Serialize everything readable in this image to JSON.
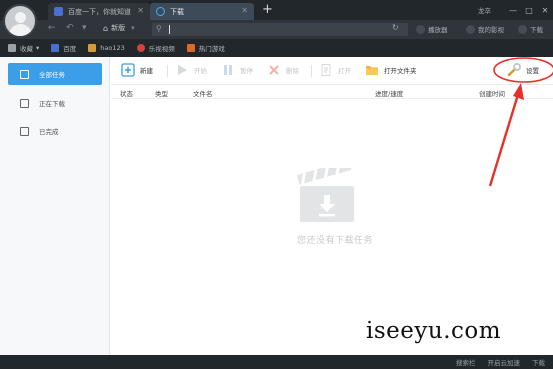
{
  "window": {
    "tabs": [
      {
        "label": "百度一下，你就知道",
        "active": false
      },
      {
        "label": "下载",
        "active": true
      }
    ],
    "new_tab_symbol": "+",
    "title_right_label": "龙卒",
    "window_buttons": [
      "—",
      "□",
      "✕"
    ]
  },
  "addressbar": {
    "home_label": "新版",
    "url_value": "",
    "quick_actions": [
      "播放器",
      "我的影视",
      "下载"
    ]
  },
  "bookmarks": [
    {
      "label": "收藏",
      "color": "#9aa0a6"
    },
    {
      "label": "百度",
      "color": "#4a6fd0"
    },
    {
      "label": "hao123",
      "color": "#d39b3a"
    },
    {
      "label": "乐视视频",
      "color": "#d0453a"
    },
    {
      "label": "热门游戏",
      "color": "#e0672a"
    }
  ],
  "sidebar": {
    "items": [
      {
        "label": "全部任务",
        "active": true
      },
      {
        "label": "正在下载",
        "active": false
      },
      {
        "label": "已完成",
        "active": false
      }
    ]
  },
  "toolbar": {
    "new_label": "新建",
    "start_label": "开始",
    "pause_label": "暂停",
    "delete_label": "删除",
    "open_label": "打开",
    "open_folder_label": "打开文件夹",
    "settings_label": "设置"
  },
  "columns": [
    "状态",
    "类型",
    "文件名",
    "进度/速度",
    "创建时间"
  ],
  "empty_state": {
    "text": "您还没有下载任务"
  },
  "statusbar": {
    "items": [
      "搜索栏",
      "开启云加速",
      "下载"
    ]
  },
  "watermark": "iseeyu.com",
  "colors": {
    "accent": "#3c9de8",
    "annotation": "#e8302a",
    "dark_chrome": "#22272c"
  },
  "icons": [
    "avatar",
    "tab-globe-icon",
    "download-tab-icon",
    "back-icon",
    "forward-icon",
    "home-icon",
    "search-icon",
    "refresh-icon",
    "new-task-icon",
    "play-icon",
    "pause-icon",
    "delete-icon",
    "open-file-icon",
    "folder-icon",
    "wrench-icon",
    "clapperboard-download-icon"
  ]
}
